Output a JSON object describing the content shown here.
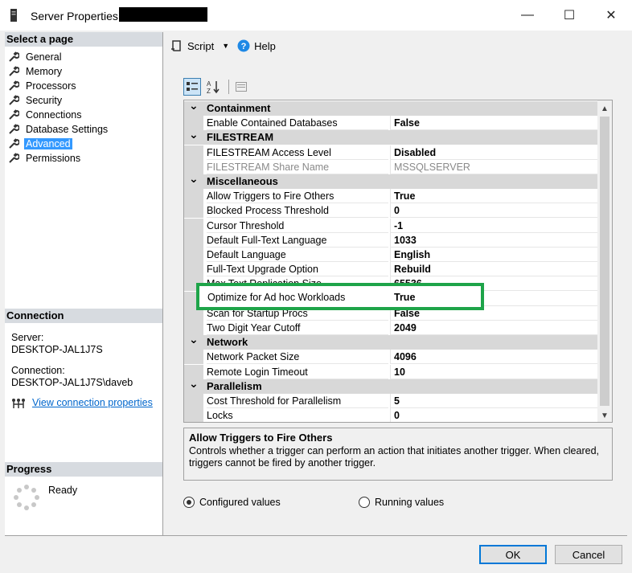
{
  "window": {
    "title": "Server Properties -",
    "minimize": "—",
    "maximize": "☐",
    "close": "✕"
  },
  "left": {
    "select_page_header": "Select a page",
    "pages": [
      {
        "label": "General"
      },
      {
        "label": "Memory"
      },
      {
        "label": "Processors"
      },
      {
        "label": "Security"
      },
      {
        "label": "Connections"
      },
      {
        "label": "Database Settings"
      },
      {
        "label": "Advanced"
      },
      {
        "label": "Permissions"
      }
    ],
    "selected_page": "Advanced",
    "connection_header": "Connection",
    "server_label": "Server:",
    "server_value": "DESKTOP-JAL1J7S",
    "connection_label": "Connection:",
    "connection_value": "DESKTOP-JAL1J7S\\daveb",
    "view_connection_link": "View connection properties",
    "progress_header": "Progress",
    "progress_status": "Ready"
  },
  "toolbar": {
    "script_label": "Script",
    "help_label": "Help"
  },
  "grid": {
    "rows": [
      {
        "type": "category",
        "label": "Containment"
      },
      {
        "type": "prop",
        "name": "Enable Contained Databases",
        "value": "False"
      },
      {
        "type": "category",
        "label": "FILESTREAM"
      },
      {
        "type": "prop",
        "name": "FILESTREAM Access Level",
        "value": "Disabled"
      },
      {
        "type": "prop",
        "name": "FILESTREAM Share Name",
        "value": "MSSQLSERVER",
        "dim": true
      },
      {
        "type": "category",
        "label": "Miscellaneous"
      },
      {
        "type": "prop",
        "name": "Allow Triggers to Fire Others",
        "value": "True"
      },
      {
        "type": "prop",
        "name": "Blocked Process Threshold",
        "value": "0"
      },
      {
        "type": "prop",
        "name": "Cursor Threshold",
        "value": "-1"
      },
      {
        "type": "prop",
        "name": "Default Full-Text Language",
        "value": "1033"
      },
      {
        "type": "prop",
        "name": "Default Language",
        "value": "English"
      },
      {
        "type": "prop",
        "name": "Full-Text Upgrade Option",
        "value": "Rebuild"
      },
      {
        "type": "prop",
        "name": "Max Text Replication Size",
        "value": "65536"
      },
      {
        "type": "prop",
        "name": "Optimize for Ad hoc Workloads",
        "value": "True"
      },
      {
        "type": "prop",
        "name": "Scan for Startup Procs",
        "value": "False"
      },
      {
        "type": "prop",
        "name": "Two Digit Year Cutoff",
        "value": "2049"
      },
      {
        "type": "category",
        "label": "Network"
      },
      {
        "type": "prop",
        "name": "Network Packet Size",
        "value": "4096"
      },
      {
        "type": "prop",
        "name": "Remote Login Timeout",
        "value": "10"
      },
      {
        "type": "category",
        "label": "Parallelism"
      },
      {
        "type": "prop",
        "name": "Cost Threshold for Parallelism",
        "value": "5"
      },
      {
        "type": "prop",
        "name": "Locks",
        "value": "0"
      }
    ],
    "highlighted": {
      "name": "Optimize for Ad hoc Workloads",
      "value": "True"
    },
    "highlight_color": "#1ea449"
  },
  "description": {
    "title": "Allow Triggers to Fire Others",
    "text": "Controls whether a trigger can perform an action that initiates another trigger. When cleared, triggers cannot be fired by another trigger."
  },
  "values_mode": {
    "configured_label": "Configured values",
    "running_label": "Running values",
    "selected": "configured"
  },
  "buttons": {
    "ok": "OK",
    "cancel": "Cancel"
  },
  "colors": {
    "selected_page_bg": "#3399ff",
    "link": "#0066cc",
    "category_bg": "#d8d8d8"
  }
}
